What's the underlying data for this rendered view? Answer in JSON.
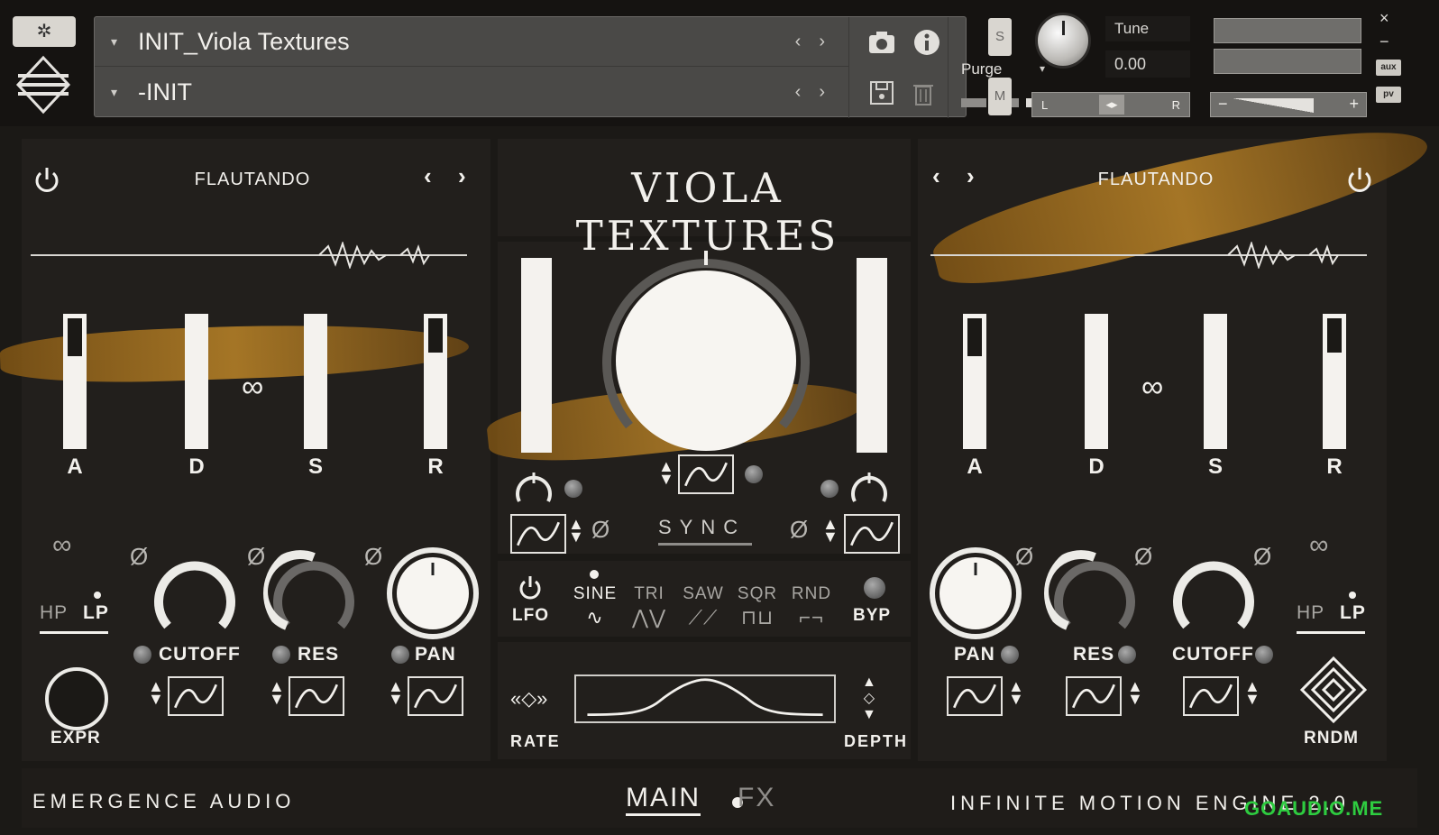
{
  "host": {
    "preset_name": "INIT_Viola Textures",
    "snapshot_name": "-INIT",
    "purge_label": "Purge",
    "solo_label": "S",
    "mute_label": "M",
    "tune_label": "Tune",
    "tune_value": "0.00",
    "pan_left": "L",
    "pan_right": "R",
    "vol_minus": "−",
    "vol_plus": "+",
    "aux_label": "aux",
    "pv_label": "pv",
    "close_glyph": "×",
    "minimize_glyph": "−",
    "prev_glyph": "‹",
    "next_glyph": "›",
    "dropdown_glyph": "▾"
  },
  "instrument": {
    "title": "VIOLA TEXTURES",
    "left_layer": {
      "name": "FLAUTANDO",
      "adsr_labels": [
        "A",
        "D",
        "S",
        "R"
      ],
      "hp_label": "HP",
      "lp_label": "LP",
      "cutoff_label": "CUTOFF",
      "res_label": "RES",
      "pan_label": "PAN",
      "expr_label": "EXPR"
    },
    "right_layer": {
      "name": "FLAUTANDO",
      "adsr_labels": [
        "A",
        "D",
        "S",
        "R"
      ],
      "hp_label": "HP",
      "lp_label": "LP",
      "cutoff_label": "CUTOFF",
      "res_label": "RES",
      "pan_label": "PAN",
      "rndm_label": "RNDM"
    },
    "center": {
      "sync_label": "SYNC",
      "lfo_label": "LFO",
      "byp_label": "BYP",
      "rate_label": "RATE",
      "depth_label": "DEPTH",
      "shapes": [
        {
          "label": "SINE",
          "glyph": "∿"
        },
        {
          "label": "TRI",
          "glyph": "⋀⋁"
        },
        {
          "label": "SAW",
          "glyph": "⟋⟋"
        },
        {
          "label": "SQR",
          "glyph": "⊓⊔"
        },
        {
          "label": "RND",
          "glyph": "⌐¬"
        }
      ]
    },
    "phase_glyph": "Ø",
    "link_glyph": "∞",
    "footer": {
      "brand": "EMERGENCE AUDIO",
      "tab_main": "MAIN",
      "tab_fx": "FX",
      "engine": "INFINITE MOTION ENGINE 2.0"
    },
    "watermark": "GOAUDIO.ME",
    "colors": {
      "accent_gold": "#c48a28",
      "panel": "#221f1c",
      "text": "#f2f0ec"
    },
    "icons": [
      "power-icon",
      "camera-icon",
      "info-icon",
      "save-icon",
      "trash-icon",
      "link-icon",
      "rndm-icon",
      "lfo-power-icon"
    ]
  }
}
